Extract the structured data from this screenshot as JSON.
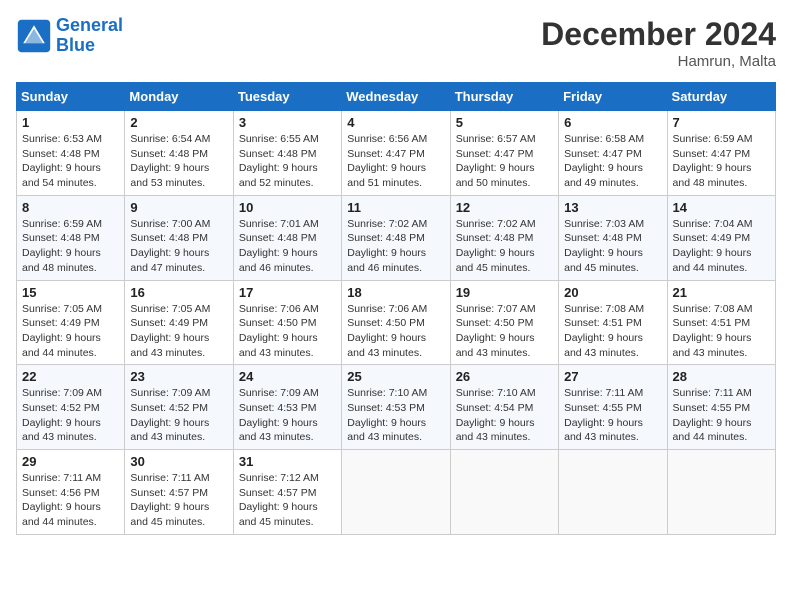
{
  "header": {
    "logo_line1": "General",
    "logo_line2": "Blue",
    "month": "December 2024",
    "location": "Hamrun, Malta"
  },
  "weekdays": [
    "Sunday",
    "Monday",
    "Tuesday",
    "Wednesday",
    "Thursday",
    "Friday",
    "Saturday"
  ],
  "weeks": [
    [
      {
        "day": "1",
        "sunrise": "Sunrise: 6:53 AM",
        "sunset": "Sunset: 4:48 PM",
        "daylight": "Daylight: 9 hours and 54 minutes."
      },
      {
        "day": "2",
        "sunrise": "Sunrise: 6:54 AM",
        "sunset": "Sunset: 4:48 PM",
        "daylight": "Daylight: 9 hours and 53 minutes."
      },
      {
        "day": "3",
        "sunrise": "Sunrise: 6:55 AM",
        "sunset": "Sunset: 4:48 PM",
        "daylight": "Daylight: 9 hours and 52 minutes."
      },
      {
        "day": "4",
        "sunrise": "Sunrise: 6:56 AM",
        "sunset": "Sunset: 4:47 PM",
        "daylight": "Daylight: 9 hours and 51 minutes."
      },
      {
        "day": "5",
        "sunrise": "Sunrise: 6:57 AM",
        "sunset": "Sunset: 4:47 PM",
        "daylight": "Daylight: 9 hours and 50 minutes."
      },
      {
        "day": "6",
        "sunrise": "Sunrise: 6:58 AM",
        "sunset": "Sunset: 4:47 PM",
        "daylight": "Daylight: 9 hours and 49 minutes."
      },
      {
        "day": "7",
        "sunrise": "Sunrise: 6:59 AM",
        "sunset": "Sunset: 4:47 PM",
        "daylight": "Daylight: 9 hours and 48 minutes."
      }
    ],
    [
      {
        "day": "8",
        "sunrise": "Sunrise: 6:59 AM",
        "sunset": "Sunset: 4:48 PM",
        "daylight": "Daylight: 9 hours and 48 minutes."
      },
      {
        "day": "9",
        "sunrise": "Sunrise: 7:00 AM",
        "sunset": "Sunset: 4:48 PM",
        "daylight": "Daylight: 9 hours and 47 minutes."
      },
      {
        "day": "10",
        "sunrise": "Sunrise: 7:01 AM",
        "sunset": "Sunset: 4:48 PM",
        "daylight": "Daylight: 9 hours and 46 minutes."
      },
      {
        "day": "11",
        "sunrise": "Sunrise: 7:02 AM",
        "sunset": "Sunset: 4:48 PM",
        "daylight": "Daylight: 9 hours and 46 minutes."
      },
      {
        "day": "12",
        "sunrise": "Sunrise: 7:02 AM",
        "sunset": "Sunset: 4:48 PM",
        "daylight": "Daylight: 9 hours and 45 minutes."
      },
      {
        "day": "13",
        "sunrise": "Sunrise: 7:03 AM",
        "sunset": "Sunset: 4:48 PM",
        "daylight": "Daylight: 9 hours and 45 minutes."
      },
      {
        "day": "14",
        "sunrise": "Sunrise: 7:04 AM",
        "sunset": "Sunset: 4:49 PM",
        "daylight": "Daylight: 9 hours and 44 minutes."
      }
    ],
    [
      {
        "day": "15",
        "sunrise": "Sunrise: 7:05 AM",
        "sunset": "Sunset: 4:49 PM",
        "daylight": "Daylight: 9 hours and 44 minutes."
      },
      {
        "day": "16",
        "sunrise": "Sunrise: 7:05 AM",
        "sunset": "Sunset: 4:49 PM",
        "daylight": "Daylight: 9 hours and 43 minutes."
      },
      {
        "day": "17",
        "sunrise": "Sunrise: 7:06 AM",
        "sunset": "Sunset: 4:50 PM",
        "daylight": "Daylight: 9 hours and 43 minutes."
      },
      {
        "day": "18",
        "sunrise": "Sunrise: 7:06 AM",
        "sunset": "Sunset: 4:50 PM",
        "daylight": "Daylight: 9 hours and 43 minutes."
      },
      {
        "day": "19",
        "sunrise": "Sunrise: 7:07 AM",
        "sunset": "Sunset: 4:50 PM",
        "daylight": "Daylight: 9 hours and 43 minutes."
      },
      {
        "day": "20",
        "sunrise": "Sunrise: 7:08 AM",
        "sunset": "Sunset: 4:51 PM",
        "daylight": "Daylight: 9 hours and 43 minutes."
      },
      {
        "day": "21",
        "sunrise": "Sunrise: 7:08 AM",
        "sunset": "Sunset: 4:51 PM",
        "daylight": "Daylight: 9 hours and 43 minutes."
      }
    ],
    [
      {
        "day": "22",
        "sunrise": "Sunrise: 7:09 AM",
        "sunset": "Sunset: 4:52 PM",
        "daylight": "Daylight: 9 hours and 43 minutes."
      },
      {
        "day": "23",
        "sunrise": "Sunrise: 7:09 AM",
        "sunset": "Sunset: 4:52 PM",
        "daylight": "Daylight: 9 hours and 43 minutes."
      },
      {
        "day": "24",
        "sunrise": "Sunrise: 7:09 AM",
        "sunset": "Sunset: 4:53 PM",
        "daylight": "Daylight: 9 hours and 43 minutes."
      },
      {
        "day": "25",
        "sunrise": "Sunrise: 7:10 AM",
        "sunset": "Sunset: 4:53 PM",
        "daylight": "Daylight: 9 hours and 43 minutes."
      },
      {
        "day": "26",
        "sunrise": "Sunrise: 7:10 AM",
        "sunset": "Sunset: 4:54 PM",
        "daylight": "Daylight: 9 hours and 43 minutes."
      },
      {
        "day": "27",
        "sunrise": "Sunrise: 7:11 AM",
        "sunset": "Sunset: 4:55 PM",
        "daylight": "Daylight: 9 hours and 43 minutes."
      },
      {
        "day": "28",
        "sunrise": "Sunrise: 7:11 AM",
        "sunset": "Sunset: 4:55 PM",
        "daylight": "Daylight: 9 hours and 44 minutes."
      }
    ],
    [
      {
        "day": "29",
        "sunrise": "Sunrise: 7:11 AM",
        "sunset": "Sunset: 4:56 PM",
        "daylight": "Daylight: 9 hours and 44 minutes."
      },
      {
        "day": "30",
        "sunrise": "Sunrise: 7:11 AM",
        "sunset": "Sunset: 4:57 PM",
        "daylight": "Daylight: 9 hours and 45 minutes."
      },
      {
        "day": "31",
        "sunrise": "Sunrise: 7:12 AM",
        "sunset": "Sunset: 4:57 PM",
        "daylight": "Daylight: 9 hours and 45 minutes."
      },
      null,
      null,
      null,
      null
    ]
  ]
}
